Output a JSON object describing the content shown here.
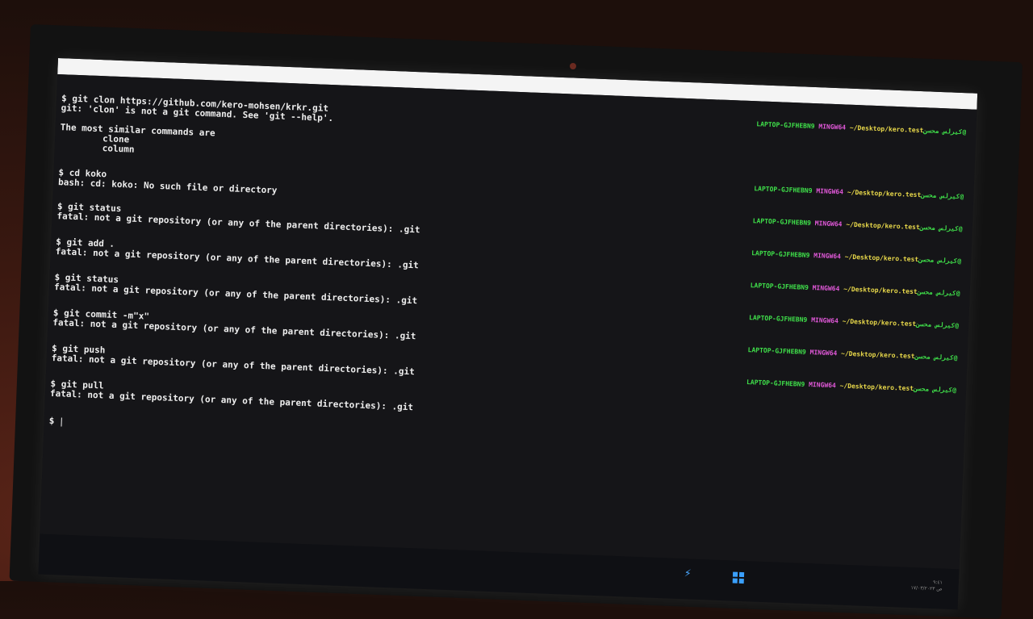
{
  "terminal": {
    "prompt_host": "LAPTOP-GJFHEBN9",
    "prompt_system": "MINGW64",
    "prompt_path": "~/Desktop/kero.test",
    "prompt_user": "کیرلس محسن@",
    "lines": [
      "$ git clon https://github.com/kero-mohsen/krkr.git",
      "git: 'clon' is not a git command. See 'git --help'.",
      "The most similar commands are",
      "        clone",
      "        column",
      "$ cd koko",
      "bash: cd: koko: No such file or directory",
      "$ git status",
      "fatal: not a git repository (or any of the parent directories): .git",
      "$ git add .",
      "fatal: not a git repository (or any of the parent directories): .git",
      "$ git status",
      "fatal: not a git repository (or any of the parent directories): .git",
      "$ git commit -m\"x\"",
      "fatal: not a git repository (or any of the parent directories): .git",
      "$ git push",
      "fatal: not a git repository (or any of the parent directories): .git",
      "$ git pull",
      "fatal: not a git repository (or any of the parent directories): .git",
      "$ "
    ]
  },
  "taskbar": {
    "tray_time": "٩:٤١",
    "tray_date": "ص ١٧/٠٣/٢٠٢٣"
  },
  "icons": [
    "start-icon",
    "app-icon",
    "led-indicator"
  ],
  "colors": {
    "terminal_bg": "#151518",
    "prompt_green": "#3fe04a",
    "prompt_magenta": "#e058d8",
    "prompt_yellow": "#e8d84a",
    "text": "#eeeeee"
  }
}
